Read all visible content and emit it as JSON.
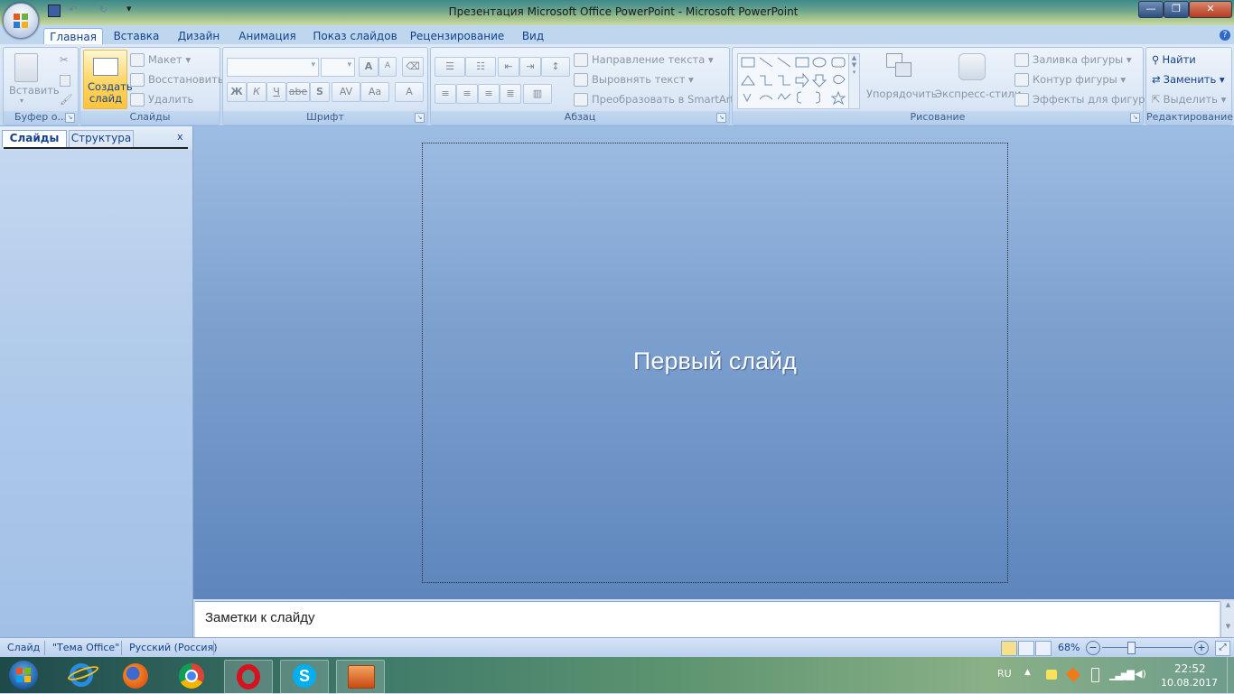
{
  "window": {
    "title": "Презентация Microsoft Office PowerPoint - Microsoft PowerPoint",
    "min_label": "—",
    "max_label": "❐",
    "close_label": "✕"
  },
  "tabs": [
    "Главная",
    "Вставка",
    "Дизайн",
    "Анимация",
    "Показ слайдов",
    "Рецензирование",
    "Вид"
  ],
  "help_label": "?",
  "ribbon": {
    "clipboard": {
      "label": "Буфер о...",
      "paste": "Вставить"
    },
    "slides": {
      "label": "Слайды",
      "new_slide_line1": "Создать",
      "new_slide_line2": "слайд",
      "layout": "Макет",
      "reset": "Восстановить",
      "delete": "Удалить"
    },
    "font": {
      "label": "Шрифт",
      "bold": "Ж",
      "italic": "К",
      "underline": "Ч",
      "strike": "abe",
      "shadow": "S",
      "spacing": "AV",
      "case": "Aa",
      "color": "A",
      "grow": "A",
      "shrink": "A"
    },
    "paragraph": {
      "label": "Абзац",
      "text_direction": "Направление текста",
      "align_text": "Выровнять текст",
      "smartart": "Преобразовать в SmartArt"
    },
    "drawing": {
      "label": "Рисование",
      "arrange": "Упорядочить",
      "quick_styles": "Экспресс-стили",
      "fill": "Заливка фигуры",
      "outline": "Контур фигуры",
      "effects": "Эффекты для фигур"
    },
    "editing": {
      "label": "Редактирование",
      "find": "Найти",
      "replace": "Заменить",
      "select": "Выделить"
    }
  },
  "leftpane": {
    "tab_slides": "Слайды",
    "tab_outline": "Структура",
    "close": "x"
  },
  "slide": {
    "title": "Первый слайд"
  },
  "notes": {
    "placeholder": "Заметки к слайду"
  },
  "status": {
    "slide": "Слайд",
    "theme": "\"Тема Office\"",
    "language": "Русский (Россия)",
    "zoom": "68%",
    "zoom_level": 0.68
  },
  "taskbar": {
    "apps": [
      "windows-start",
      "internet-explorer",
      "firefox",
      "chrome",
      "opera",
      "skype",
      "powerpoint"
    ],
    "lang": "RU",
    "time": "22:52",
    "date": "10.08.2017"
  },
  "colors": {
    "accent": "#15428b",
    "slide_bg_top": "#9ebde3",
    "slide_bg_bottom": "#5e86bd"
  }
}
